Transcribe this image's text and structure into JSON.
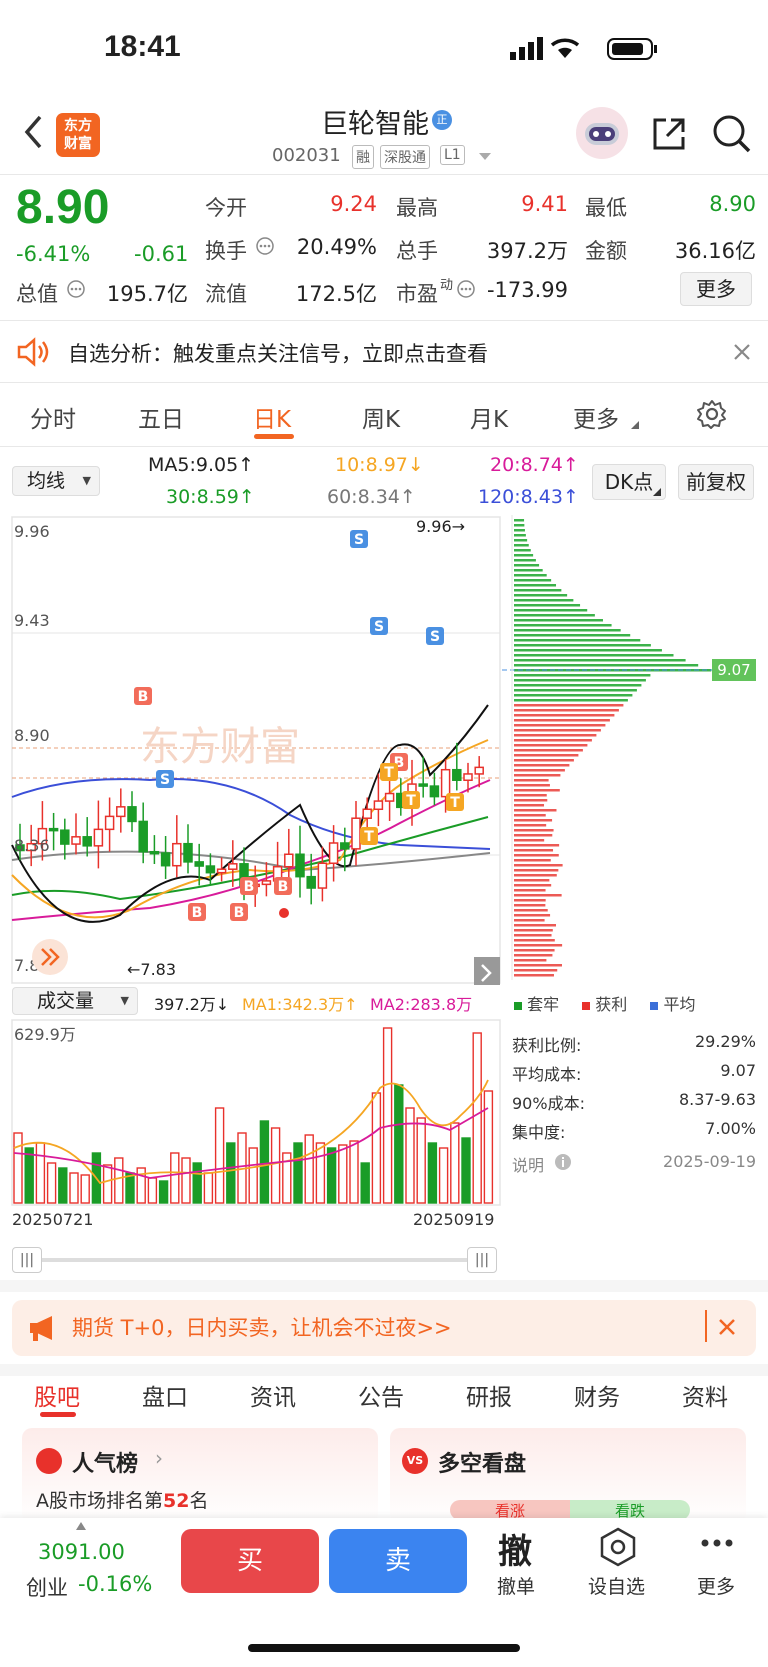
{
  "status_bar": {
    "time": "18:41"
  },
  "header": {
    "logo_line1": "东方",
    "logo_line2": "财富",
    "stock_name": "巨轮智能",
    "zheng_badge": "正",
    "stock_code": "002031",
    "tags": [
      "融",
      "深股通",
      "L1"
    ]
  },
  "quote": {
    "price": "8.90",
    "change_pct": "-6.41%",
    "change": "-0.61",
    "open_label": "今开",
    "open": "9.24",
    "high_label": "最高",
    "high": "9.41",
    "low_label": "最低",
    "low": "8.90",
    "turnover_label": "换手",
    "turnover": "20.49%",
    "volume_label": "总手",
    "volume": "397.2万",
    "amount_label": "金额",
    "amount": "36.16亿",
    "mktcap_label": "总值",
    "mktcap": "195.7亿",
    "float_label": "流值",
    "float": "172.5亿",
    "pe_label": "市盈",
    "pe_sup": "动",
    "pe": "-173.99",
    "more_label": "更多"
  },
  "alert": {
    "text": "自选分析：触发重点关注信号，立即点击查看"
  },
  "chart_tabs": [
    "分时",
    "五日",
    "日K",
    "周K",
    "月K",
    "更多"
  ],
  "ma": {
    "selector": "均线",
    "ma5": "MA5:9.05↑",
    "ma10": "10:8.97↓",
    "ma20": "20:8.74↑",
    "ma30": "30:8.59↑",
    "ma60": "60:8.34↑",
    "ma120": "120:8.43↑",
    "dk_label": "DK点",
    "fq_label": "前复权",
    "colors": {
      "ma5": "#222222",
      "ma10": "#f5a623",
      "ma20": "#d81b9a",
      "ma30": "#1a9c27",
      "ma60": "#888888",
      "ma120": "#3b4fd8"
    }
  },
  "kline": {
    "axis": [
      "9.96",
      "9.43",
      "8.90",
      "8.36",
      "7.83"
    ],
    "max_label": "9.96→",
    "min_label": "←7.83",
    "watermark": "东方财富",
    "chip_avg": "9.07"
  },
  "volume": {
    "selector": "成交量",
    "vol": "397.2万↓",
    "ma1": "MA1:342.3万↑",
    "ma2": "MA2:283.8万",
    "axis_top": "629.9万",
    "date_start": "20250721",
    "date_end": "20250919"
  },
  "chips": {
    "legend": [
      "套牢",
      "获利",
      "平均"
    ],
    "stats": [
      {
        "label": "获利比例:",
        "value": "29.29%"
      },
      {
        "label": "平均成本:",
        "value": "9.07"
      },
      {
        "label": "90%成本:",
        "value": "8.37-9.63"
      },
      {
        "label": "集中度:",
        "value": "7.00%"
      }
    ],
    "note_label": "说明",
    "date": "2025-09-19"
  },
  "promo": {
    "text": "期货 T+0，日内买卖，让机会不过夜>>"
  },
  "info_tabs": [
    "股吧",
    "盘口",
    "资讯",
    "公告",
    "研报",
    "财务",
    "资料"
  ],
  "cards": {
    "popularity_title": "人气榜",
    "popularity_sub_prefix": "A股市场排名第",
    "popularity_rank": "52",
    "popularity_sub_suffix": "名",
    "longshort_title": "多空看盘",
    "bull": "看涨",
    "bear": "看跌"
  },
  "bottom": {
    "index_value": "3091.00",
    "index_name": "创业",
    "index_change": "-0.16%",
    "buy": "买",
    "sell": "卖",
    "cancel_glyph": "撤",
    "cancel_label": "撤单",
    "watch_label": "设自选",
    "more_label": "更多"
  }
}
